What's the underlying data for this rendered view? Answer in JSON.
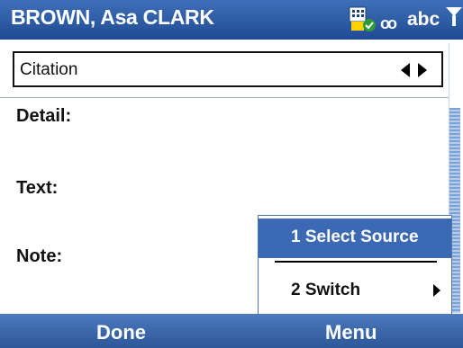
{
  "titlebar": {
    "title": "BROWN, Asa CLARK",
    "input_mode": "abc",
    "icons": [
      "sync-icon",
      "voicemail-icon",
      "signal-icon"
    ]
  },
  "citation": {
    "label": "Citation"
  },
  "fields": {
    "detail_label": "Detail:",
    "text_label": "Text:",
    "note_label": "Note:"
  },
  "popup_menu": {
    "items": [
      {
        "label": "1 Select Source",
        "selected": true
      },
      {
        "label": "2 Switch",
        "submenu": true
      }
    ]
  },
  "softkeys": {
    "left": "Done",
    "right": "Menu"
  },
  "colors": {
    "titlebar": "#2f5da6",
    "selection": "#3b69b3",
    "softkeys": "#3a67ad"
  }
}
